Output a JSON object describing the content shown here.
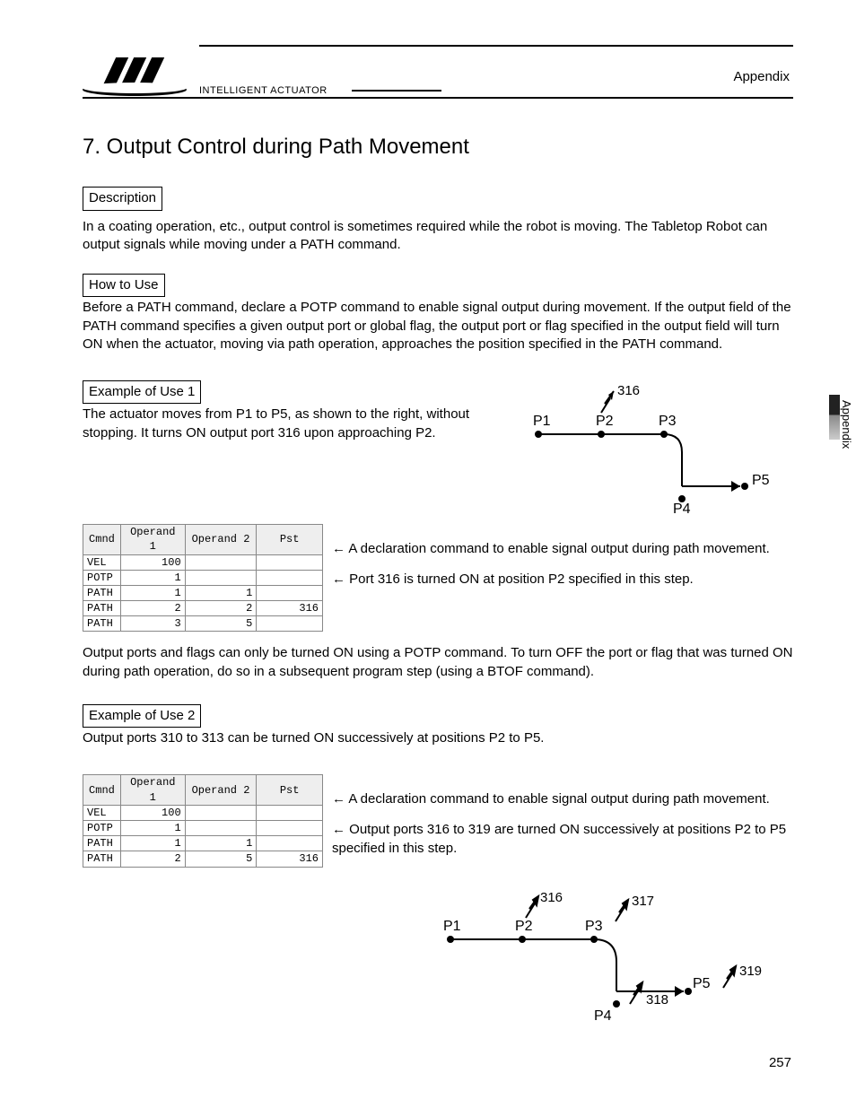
{
  "header": {
    "brand": "INTELLIGENT ACTUATOR",
    "section": "Appendix"
  },
  "title": "7.   Output Control during Path Movement",
  "labels": {
    "description": "Description",
    "howto": "How to Use",
    "ex1": "Example of Use 1",
    "ex2": "Example of Use 2"
  },
  "desc_text": "In a coating operation, etc., output control is sometimes required while the robot is moving. The Tabletop Robot can output signals while moving under a PATH command.",
  "howto_text": "Before a PATH command, declare a POTP command to enable signal output during movement. If the output field of the PATH command specifies a given output port or global flag, the output port or flag specified in the output field will turn ON when the actuator, moving via path operation, approaches the position specified in the PATH command.",
  "ex1_text": "The actuator moves from P1 to P5, as shown to the right, without stopping. It turns ON output port 316 upon approaching P2.",
  "table_headers": {
    "cmd": "Cmnd",
    "op1": "Operand 1",
    "op2": "Operand 2",
    "pst": "Pst"
  },
  "table1": [
    {
      "cmd": "VEL",
      "op1": "100",
      "op2": "",
      "pst": "",
      "anno": ""
    },
    {
      "cmd": "POTP",
      "op1": "1",
      "op2": "",
      "pst": "",
      "anno": "← A declaration command to enable signal output during path movement."
    },
    {
      "cmd": "PATH",
      "op1": "1",
      "op2": "1",
      "pst": "",
      "anno": ""
    },
    {
      "cmd": "PATH",
      "op1": "2",
      "op2": "2",
      "pst": "316",
      "anno": "← Port 316 is turned ON at position P2 specified in this step."
    },
    {
      "cmd": "PATH",
      "op1": "3",
      "op2": "5",
      "pst": "",
      "anno": ""
    }
  ],
  "between_text": "Output ports and flags can only be turned ON using a POTP command. To turn OFF the port or flag that was turned ON during path operation, do so in a subsequent program step (using a BTOF command).",
  "ex2_text": "Output ports 310 to 313 can be turned ON successively at positions P2 to P5.",
  "table2": [
    {
      "cmd": "VEL",
      "op1": "100",
      "op2": "",
      "pst": "",
      "anno": ""
    },
    {
      "cmd": "POTP",
      "op1": "1",
      "op2": "",
      "pst": "",
      "anno": "← A declaration command to enable signal output during path movement."
    },
    {
      "cmd": "PATH",
      "op1": "1",
      "op2": "1",
      "pst": "",
      "anno": ""
    },
    {
      "cmd": "PATH",
      "op1": "2",
      "op2": "5",
      "pst": "316",
      "anno": "← Output ports 316 to 319 are turned ON successively at positions P2 to P5 specified in this step."
    }
  ],
  "diagram1": {
    "points": {
      "P1": "P1",
      "P2": "P2",
      "P3": "P3",
      "P4": "P4",
      "P5": "P5"
    },
    "flash": "316"
  },
  "diagram2": {
    "points": {
      "P1": "P1",
      "P2": "P2",
      "P3": "P3",
      "P4": "P4",
      "P5": "P5"
    },
    "flash": {
      "p2": "316",
      "p3": "317",
      "p4": "318",
      "p5": "319"
    }
  },
  "side_tab": "Appendix",
  "page_number": "257"
}
